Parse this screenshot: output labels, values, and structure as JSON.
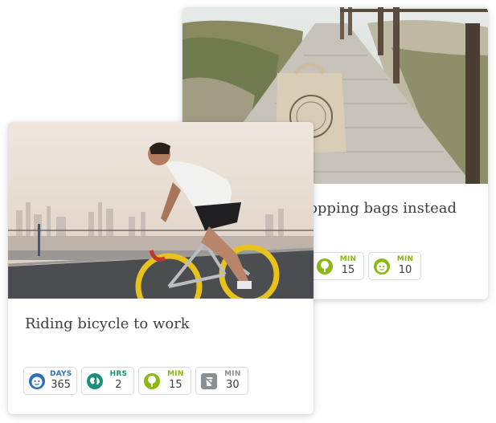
{
  "cards": [
    {
      "title": "opping bags instead",
      "image": "beach-boardwalk-tote-bag",
      "stats": [
        {
          "unit": "MIN",
          "value": "15",
          "icon": "tree-icon",
          "color": "#8cb812"
        },
        {
          "unit": "MIN",
          "value": "10",
          "icon": "face-icon",
          "color": "#8cb812"
        }
      ]
    },
    {
      "title": "Riding bicycle to work",
      "image": "cyclist-city-skyline",
      "stats": [
        {
          "unit": "DAYS",
          "value": "365",
          "icon": "face-icon",
          "color": "#2f6fb8"
        },
        {
          "unit": "HRS",
          "value": "2",
          "icon": "globe-icon",
          "color": "#17917a"
        },
        {
          "unit": "MIN",
          "value": "15",
          "icon": "tree-icon",
          "color": "#8cb812"
        },
        {
          "unit": "MIN",
          "value": "30",
          "icon": "trash-icon",
          "color": "#8a8f94"
        }
      ]
    }
  ]
}
